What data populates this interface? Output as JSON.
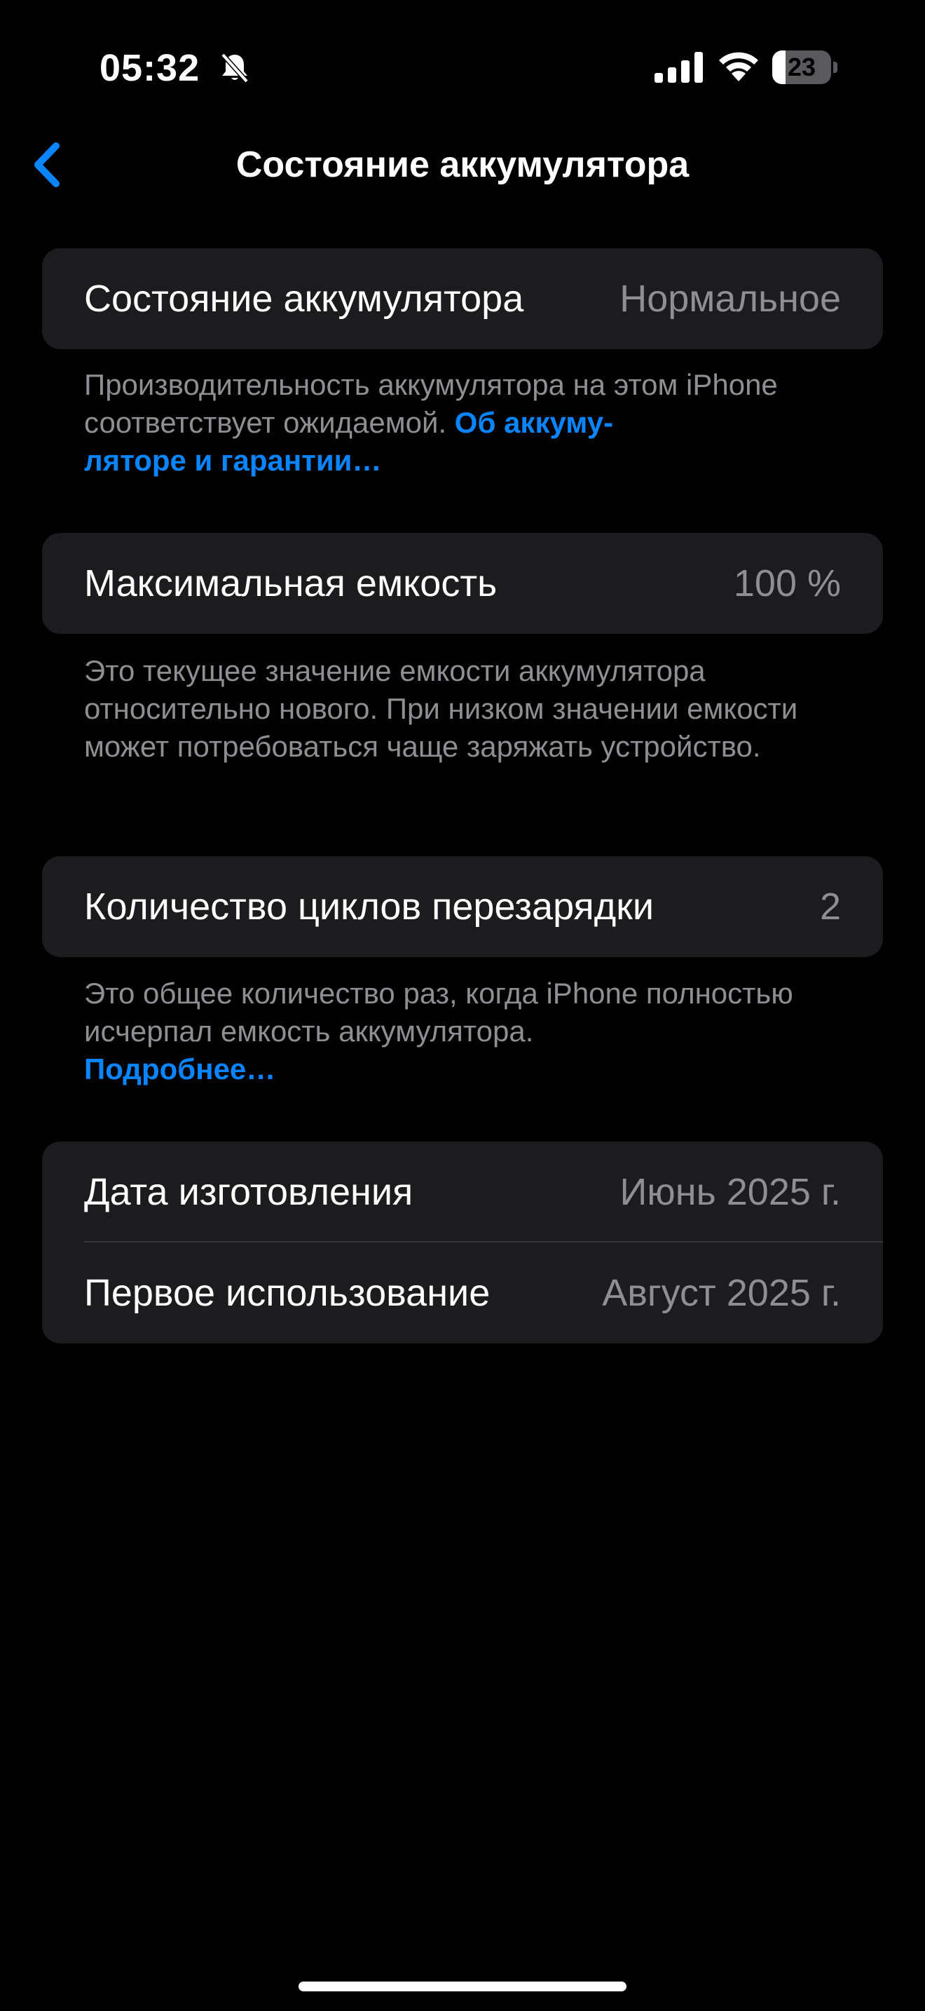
{
  "status_bar": {
    "time": "05:32",
    "battery_level": "23",
    "battery_fraction": 0.23
  },
  "nav": {
    "title": "Состояние аккумулятора"
  },
  "sections": {
    "health": {
      "label": "Состояние аккумулятора",
      "value": "Нормальное",
      "footer_text": "Производительность аккумулятора на этом iPhone соответствует ожидаемой. ",
      "footer_link": "Об аккуму-\nляторе и гарантии…"
    },
    "capacity": {
      "label": "Максимальная емкость",
      "value": "100 %",
      "footer_text": "Это текущее значение емкости аккумулятора относительно нового. При низком значении емкости может потребоваться чаще заряжать устройство."
    },
    "cycles": {
      "label": "Количество циклов перезарядки",
      "value": "2",
      "footer_text": "Это общее количество раз, когда iPhone полностью исчерпал емкость аккумулятора.",
      "footer_link": "Подробнее…"
    },
    "dates": {
      "manufacture_label": "Дата изготовления",
      "manufacture_value": "Июнь 2025 г.",
      "first_use_label": "Первое использование",
      "first_use_value": "Август 2025 г."
    }
  },
  "colors": {
    "background": "#000000",
    "card": "#1c1c1e",
    "secondary_text": "#8e8e93",
    "accent": "#0a84ff"
  }
}
